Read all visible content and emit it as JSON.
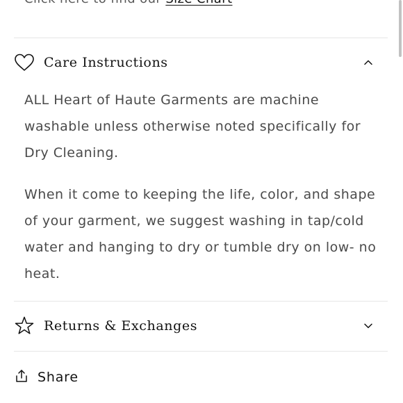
{
  "size_chart": {
    "prefix": "Click here to find our ",
    "link": "Size Chart"
  },
  "accordions": [
    {
      "title": "Care Instructions",
      "icon": "heart-icon",
      "expanded": true,
      "paragraphs": [
        "ALL Heart of Haute Garments are machine washable unless otherwise noted specifically for Dry Cleaning.",
        "When it come to keeping the life, color, and shape of your garment, we suggest washing in tap/cold water and hanging to dry or tumble dry on low- no heat."
      ]
    },
    {
      "title": "Returns & Exchanges",
      "icon": "star-icon",
      "expanded": false
    }
  ],
  "share": {
    "label": "Share",
    "icon": "share-icon"
  },
  "colors": {
    "text": "#121212",
    "body_text": "#4a4a4a",
    "divider": "#e6e6e6"
  }
}
